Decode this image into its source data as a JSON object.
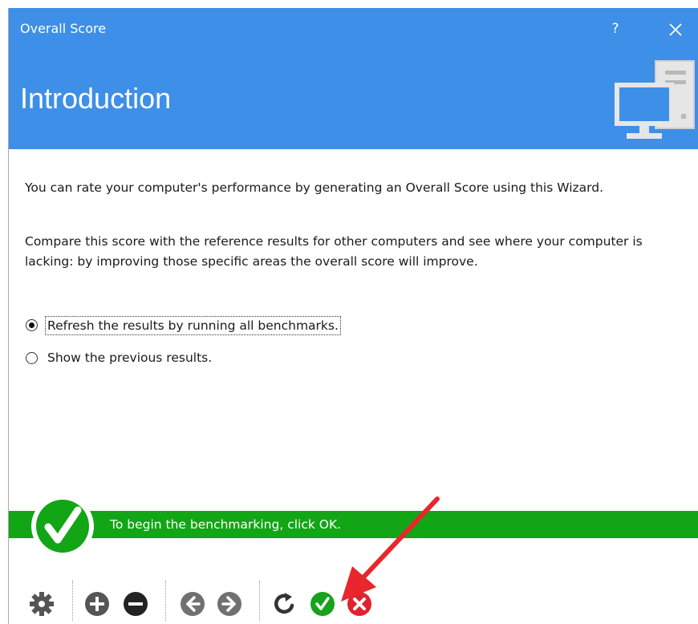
{
  "window": {
    "title": "Overall Score",
    "help_label": "?"
  },
  "header": {
    "heading": "Introduction",
    "illustration_icon": "computer-tower-icon"
  },
  "content": {
    "paragraph1": "You can rate your computer's performance by generating an Overall Score using this Wizard.",
    "paragraph2": "Compare this score with the reference results for other computers and see where your computer is lacking: by improving those specific areas the overall score will improve.",
    "options": [
      {
        "label": "Refresh the results by running all benchmarks.",
        "selected": true
      },
      {
        "label": "Show the previous results.",
        "selected": false
      }
    ]
  },
  "banner": {
    "text": "To begin the benchmarking, click OK.",
    "icon": "checkmark-icon"
  },
  "toolbar": {
    "buttons": [
      "gear-icon",
      "add-icon",
      "remove-icon",
      "back-icon",
      "forward-icon",
      "refresh-icon",
      "ok-icon",
      "cancel-icon"
    ]
  },
  "colors": {
    "title_blue": "#3e8fe7",
    "banner_green": "#12a516",
    "ok_green": "#17a21b",
    "cancel_red": "#e0222f",
    "arrow_red": "#e8262c",
    "icon_gray": "#555555"
  }
}
